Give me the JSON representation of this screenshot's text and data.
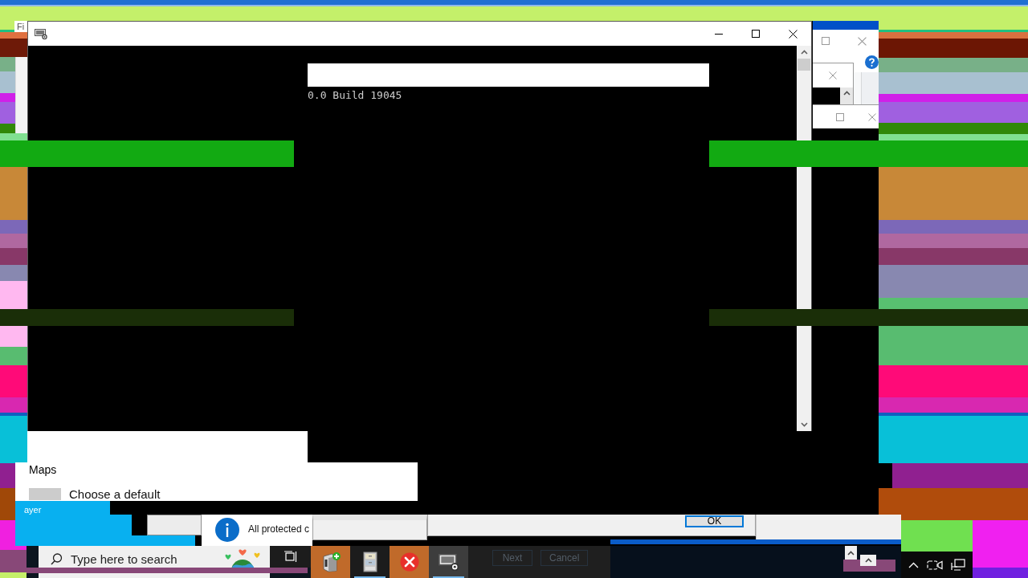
{
  "background_window": {
    "title_fragment": "Fi"
  },
  "console_window": {
    "output_lines": [
      "0.0 Build 19045"
    ]
  },
  "settings_panel": {
    "heading": "Maps",
    "option": "Choose a default"
  },
  "window_fragment": {
    "text": "ayer"
  },
  "notification": {
    "text": "All protected c"
  },
  "dialog": {
    "buttons": [
      "OK"
    ]
  },
  "taskbar": {
    "search": {
      "placeholder": "Type here to search"
    },
    "apps": [
      {
        "kind": "computer",
        "selected": false,
        "running": false
      },
      {
        "kind": "cabinet",
        "selected": false,
        "running": true
      },
      {
        "kind": "error",
        "selected": false,
        "running": false
      },
      {
        "kind": "console",
        "selected": true,
        "running": true
      }
    ]
  },
  "ghost_dialog": {
    "buttons": [
      "Next",
      "Cancel"
    ]
  }
}
